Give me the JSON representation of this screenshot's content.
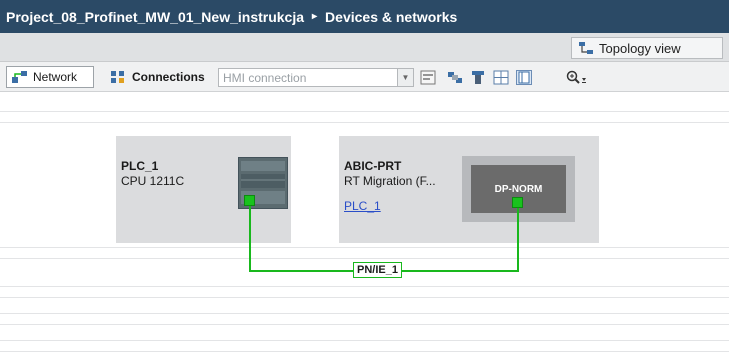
{
  "title": {
    "project": "Project_08_Profinet_MW_01_New_instrukcja",
    "separator": "▸",
    "section": "Devices & networks"
  },
  "view_tabs": {
    "topology": "Topology view"
  },
  "toolbar": {
    "network_label": "Network",
    "connections_label": "Connections",
    "hmi_select_value": "HMI connection",
    "icon_names": [
      "names-icon",
      "plug-icon",
      "device-icon",
      "grid-icon",
      "table-icon",
      "zoom-icon"
    ]
  },
  "devices": [
    {
      "name": "PLC_1",
      "type": "CPU 1211C",
      "link": ""
    },
    {
      "name": "ABIC-PRT",
      "type": "RT Migration (F...",
      "link": "PLC_1",
      "module_label": "DP-NORM"
    }
  ],
  "network": {
    "label": "PN/IE_1"
  },
  "colors": {
    "title_bar": "#2b4a66",
    "profinet_wire": "#19b81d",
    "port": "#19c21d",
    "device_box": "#dbdcde"
  }
}
